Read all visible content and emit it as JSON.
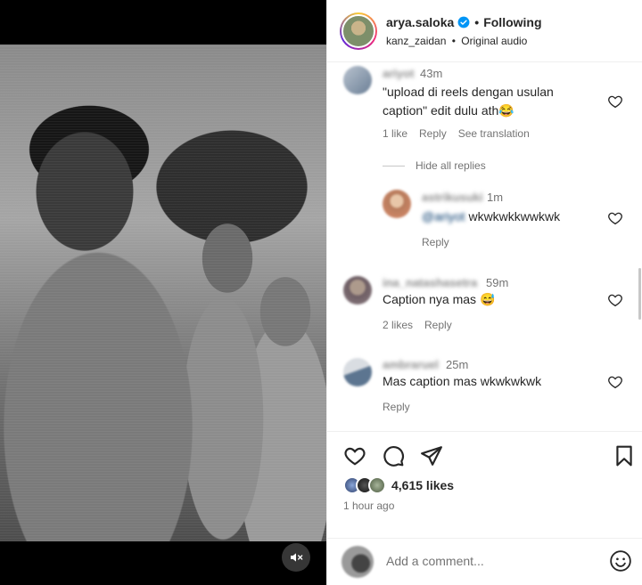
{
  "header": {
    "username": "arya.saloka",
    "dot": "•",
    "follow_status": "Following",
    "audio_user": "kanz_zaidan",
    "audio_sep": "•",
    "audio_label": "Original audio"
  },
  "comments": [
    {
      "username": "ariyot",
      "time": "43m",
      "text": "\"upload di reels dengan usulan caption\" edit dulu ath😂",
      "likes": "1 like",
      "reply": "Reply",
      "translate": "See translation"
    },
    {
      "hide_replies": "Hide all replies"
    },
    {
      "username": "astrikusuki",
      "time": "1m",
      "mention": "@ariyot",
      "text": "wkwkwkkwwkwk",
      "reply": "Reply"
    },
    {
      "username": "ina_natashasetra",
      "time": "59m",
      "text": "Caption nya mas 😅",
      "likes": "2 likes",
      "reply": "Reply"
    },
    {
      "username": "ambraruel",
      "time": "25m",
      "text": "Mas caption mas wkwkwkwk",
      "reply": "Reply"
    }
  ],
  "actions": {
    "likes_count": "4,615 likes",
    "time_ago": "1 hour ago"
  },
  "add_comment": {
    "placeholder": "Add a comment..."
  },
  "icons": {
    "mute": "speaker-muted-icon",
    "verified": "verified-badge-icon",
    "like": "heart-icon",
    "comment": "comment-bubble-icon",
    "share": "paper-plane-icon",
    "save": "bookmark-icon",
    "emoji": "smiley-icon"
  },
  "colors": {
    "verified_blue": "#0095f6",
    "link_blue": "#00376b",
    "muted_text": "#737373"
  }
}
